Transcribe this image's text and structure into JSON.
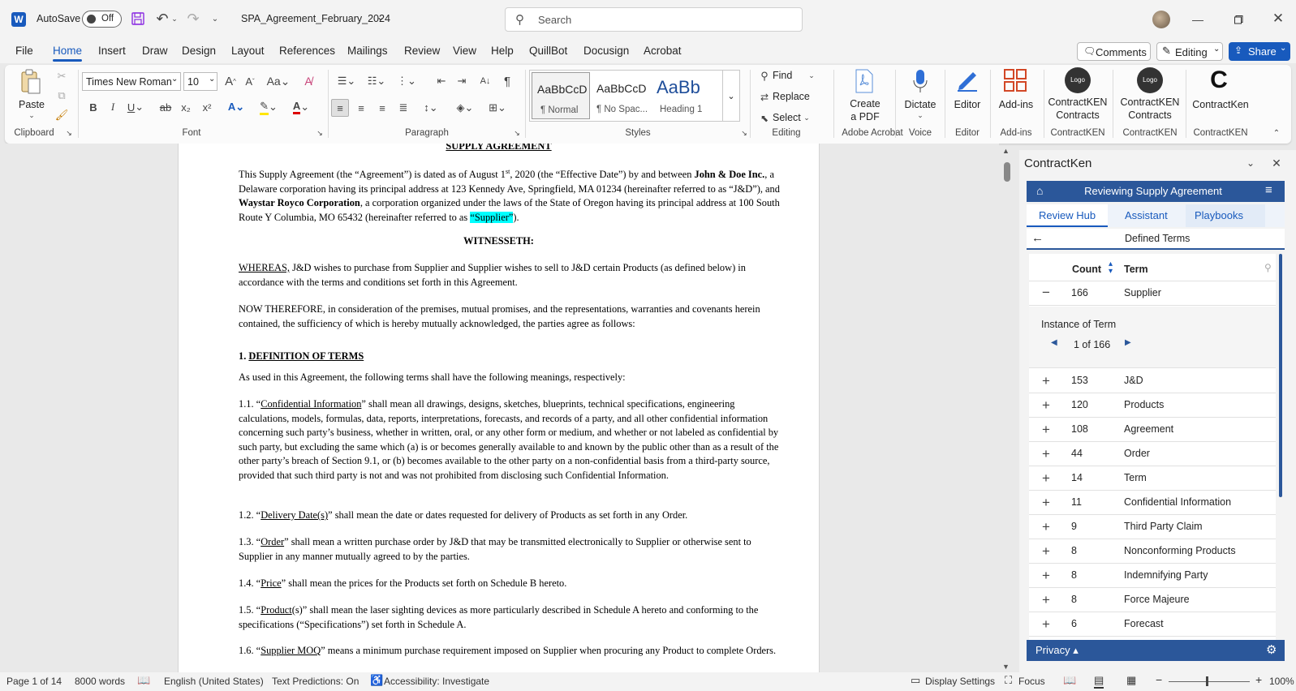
{
  "titlebar": {
    "app_icon": "W",
    "autosave_label": "AutoSave",
    "autosave_state": "Off",
    "doc_name": "SPA_Agreement_February_2024",
    "search_placeholder": "Search"
  },
  "menu_tabs": [
    "File",
    "Home",
    "Insert",
    "Draw",
    "Design",
    "Layout",
    "References",
    "Mailings",
    "Review",
    "View",
    "Help",
    "QuillBot",
    "Docusign",
    "Acrobat"
  ],
  "top_right": {
    "comments": "Comments",
    "editing": "Editing",
    "share": "Share"
  },
  "ribbon": {
    "paste": "Paste",
    "clipboard": "Clipboard",
    "font_name": "Times New Roman",
    "font_size": "10",
    "font": "Font",
    "paragraph": "Paragraph",
    "style1_sample": "AaBbCcD",
    "style1_name": "¶ Normal",
    "style2_sample": "AaBbCcD",
    "style2_name": "¶ No Spac...",
    "style3_sample": "AaBb",
    "style3_name": "Heading 1",
    "styles": "Styles",
    "find": "Find",
    "replace": "Replace",
    "select": "Select",
    "editing": "Editing",
    "create_pdf1": "Create",
    "create_pdf2": "a PDF",
    "adobe": "Adobe Acrobat",
    "dictate": "Dictate",
    "voice": "Voice",
    "editor_btn": "Editor",
    "editor_grp": "Editor",
    "addins_btn": "Add-ins",
    "addins_grp": "Add-ins",
    "ck1a": "ContractKEN",
    "ck1b": "Contracts",
    "ck1g": "ContractKEN",
    "ck2a": "ContractKEN",
    "ck2b": "Contracts",
    "ck2g": "ContractKEN",
    "ck3a": "ContractKen",
    "ck3g": "ContractKEN",
    "logo": "Logo"
  },
  "doc": {
    "title": "SUPPLY AGREEMENT",
    "p1a": "This Supply Agreement (the “Agreement”) is dated as of August 1",
    "p1sup": "st",
    "p1b": ", 2020 (the “Effective Date”) by and between ",
    "p1c": "John & Doe Inc.",
    "p1d": ", a Delaware corporation having its principal address at 123 Kennedy Ave, Springfield, MA 01234 (hereinafter referred to as “J&D”), and ",
    "p1e": "Waystar Royco Corporation",
    "p1f": ", a corporation organized under the laws of the State of Oregon having its principal address at 100 South Route Y Columbia, MO 65432 (hereinafter referred to as ",
    "p1g": "“Supplier”",
    "p1h": ").",
    "witness": "WITNESSETH:",
    "w1": "WHEREAS,",
    "w2": " J&D wishes to purchase from Supplier and Supplier wishes to sell to J&D certain Products (as defined below) in accordance with the terms and conditions set forth in this Agreement.",
    "now": "NOW THEREFORE, in consideration of the premises, mutual promises, and the representations, warranties and covenants herein contained, the sufficiency of which is hereby mutually acknowledged, the parties agree as follows:",
    "h1num": "1. ",
    "h1": "DEFINITION OF TERMS",
    "asused": "As used in this Agreement, the following terms shall have the following meanings, respectively:",
    "d11a": "1.1. “",
    "d11b": "Confidential Information",
    "d11c": "” shall mean all drawings, designs, sketches, blueprints, technical specifications, engineering calculations, models, formulas, data, reports, interpretations, forecasts, and records of a party, and all other confidential information concerning such party’s business, whether in written, oral, or any other form or medium, and whether or not labeled as confidential by such party, but excluding the same which (a) is or becomes generally available to and known by the public other than as a result of the other party’s breach of Section 9.1, or (b) becomes available to the other party on a non-confidential basis from a third-party source, provided that such third party is not and was not prohibited from disclosing such Confidential Information.",
    "d12a": "1.2. “",
    "d12b": "Delivery Date(s)",
    "d12c": "” shall mean the date or dates requested for delivery of Products as set forth in any Order.",
    "d13a": "1.3. “",
    "d13b": "Order",
    "d13c": "” shall mean a written purchase order by J&D that may be transmitted electronically to Supplier or otherwise sent to Supplier in any manner mutually agreed to by the parties.",
    "d14a": "1.4. “",
    "d14b": "Price",
    "d14c": "” shall mean the prices for the Products set forth on Schedule B hereto.",
    "d15a": "1.5. “",
    "d15b": "Product",
    "d15c": "(s)” shall mean the laser sighting devices as more particularly described in Schedule A hereto and conforming to the specifications (“Specifications”) set forth in Schedule A.",
    "d16a": "1.6. “",
    "d16b": "Supplier MOQ",
    "d16c": "” means a minimum purchase requirement imposed on Supplier when procuring any Product to complete Orders."
  },
  "pane": {
    "title": "ContractKen",
    "header": "Reviewing Supply Agreement",
    "tabs": [
      "Review Hub",
      "Assistant",
      "Playbooks"
    ],
    "section": "Defined Terms",
    "col_count": "Count",
    "col_term": "Term",
    "expanded_count": "166",
    "expanded_term": "Supplier",
    "instance_label": "Instance of Term",
    "instance_nav": "1 of 166",
    "rows": [
      {
        "count": "153",
        "term": "J&D"
      },
      {
        "count": "120",
        "term": "Products"
      },
      {
        "count": "108",
        "term": "Agreement"
      },
      {
        "count": "44",
        "term": "Order"
      },
      {
        "count": "14",
        "term": "Term"
      },
      {
        "count": "11",
        "term": "Confidential Information"
      },
      {
        "count": "9",
        "term": "Third Party Claim"
      },
      {
        "count": "8",
        "term": "Nonconforming Products"
      },
      {
        "count": "8",
        "term": "Indemnifying Party"
      },
      {
        "count": "8",
        "term": "Force Majeure"
      },
      {
        "count": "6",
        "term": "Forecast"
      }
    ],
    "privacy": "Privacy"
  },
  "status": {
    "page": "Page 1 of 14",
    "words": "8000 words",
    "language": "English (United States)",
    "predictions": "Text Predictions: On",
    "accessibility": "Accessibility: Investigate",
    "display": "Display Settings",
    "focus": "Focus",
    "zoom": "100%"
  },
  "colors": {
    "accent": "#185abd",
    "pane_header": "#2b579a",
    "highlight": "#00ffff"
  }
}
